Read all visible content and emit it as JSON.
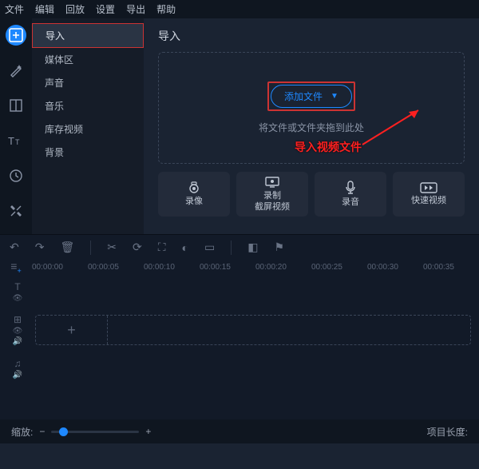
{
  "menubar": [
    "文件",
    "编辑",
    "回放",
    "设置",
    "导出",
    "帮助"
  ],
  "lefticons": [
    {
      "name": "import-icon",
      "glyph": "plus-square",
      "active": true
    },
    {
      "name": "magic-icon",
      "glyph": "wand"
    },
    {
      "name": "split-icon",
      "glyph": "split"
    },
    {
      "name": "text-icon",
      "glyph": "text"
    },
    {
      "name": "time-icon",
      "glyph": "clock"
    },
    {
      "name": "tools-icon",
      "glyph": "wrench"
    }
  ],
  "sidepanel": {
    "items": [
      {
        "label": "导入",
        "active": true
      },
      {
        "label": "媒体区"
      },
      {
        "label": "声音"
      },
      {
        "label": "音乐"
      },
      {
        "label": "库存视频"
      },
      {
        "label": "背景"
      }
    ]
  },
  "content": {
    "title": "导入",
    "add_btn": "添加文件",
    "drop_hint": "将文件或文件夹拖到此处",
    "annotation": "导入视频文件"
  },
  "tiles": [
    {
      "name": "record-cam",
      "icon": "cam",
      "label": "录像"
    },
    {
      "name": "record-screen",
      "icon": "screen",
      "label": "录制\n截屏视频"
    },
    {
      "name": "record-audio",
      "icon": "mic",
      "label": "录音"
    },
    {
      "name": "quick-video",
      "icon": "fast",
      "label": "快速视频"
    }
  ],
  "timeline_tools": {
    "left": [
      "undo",
      "redo",
      "delete"
    ],
    "right": [
      "cut",
      "rotate",
      "crop",
      "color",
      "clip",
      "marker",
      "flag"
    ]
  },
  "ruler": [
    "00:00:00",
    "00:00:05",
    "00:00:10",
    "00:00:15",
    "00:00:20",
    "00:00:25",
    "00:00:30",
    "00:00:35"
  ],
  "statusbar": {
    "zoom_label": "缩放:",
    "length_label": "项目长度:"
  }
}
